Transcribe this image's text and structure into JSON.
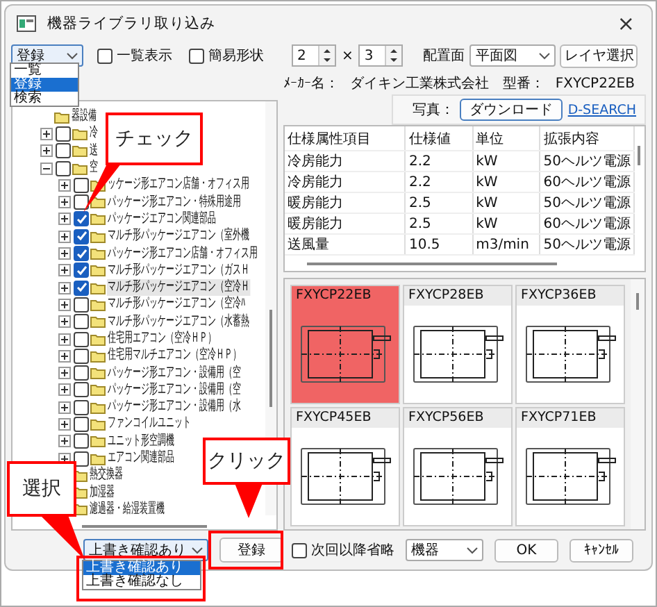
{
  "window": {
    "title": "機器ライブラリ取り込み",
    "close": "×"
  },
  "mode_select": {
    "value": "登録",
    "options": [
      {
        "label": "一覧",
        "selected": false
      },
      {
        "label": "登録",
        "selected": true
      },
      {
        "label": "検索",
        "selected": false
      }
    ]
  },
  "options": [
    {
      "label": "一覧表示",
      "checked": false
    },
    {
      "label": "簡易形状",
      "checked": false
    }
  ],
  "grid_size": {
    "rows": "2",
    "separator": "×",
    "cols": "3"
  },
  "layout_plane": {
    "label": "配置面",
    "value": "平面図"
  },
  "layer_button": "レイヤ選択",
  "maker": {
    "label": "ﾒｰｶｰ名：",
    "value": "ダイキン工業株式会社"
  },
  "model": {
    "label": "型番：",
    "value": "FXYCP22EB"
  },
  "photo": {
    "label": "写真：",
    "button": "ダウンロード",
    "link": "D-SEARCH"
  },
  "tree": {
    "items": [
      {
        "label": "器設備",
        "children": [
          {
            "label": "冷",
            "expanded": false,
            "checked": false
          },
          {
            "label": "送",
            "expanded": false,
            "checked": false
          },
          {
            "label": "空",
            "expanded": true,
            "checked": false,
            "children": [
              {
                "label": "ッケージ形エアコン店舗・オフィス用",
                "expanded": false,
                "checked": false,
                "selected": false
              },
              {
                "label": "パッケージ形エアコン・特殊用途用",
                "expanded": false,
                "checked": false,
                "selected": false
              },
              {
                "label": "パッケージエアコン関連部品",
                "expanded": false,
                "checked": true,
                "selected": false
              },
              {
                "label": "マルチ形パッケージエアコン（室外機",
                "expanded": false,
                "checked": true,
                "selected": false
              },
              {
                "label": "パッケージ形エアコン店舗・オフィス用",
                "expanded": false,
                "checked": true,
                "selected": false
              },
              {
                "label": "マルチ形パッケージエアコン（ガスＨ",
                "expanded": false,
                "checked": true,
                "selected": false
              },
              {
                "label": "マルチ形パッケージエアコン（空冷Ｈ",
                "expanded": false,
                "checked": true,
                "selected": true
              },
              {
                "label": "マルチ形パッケージエアコン（空冷ﾊ",
                "expanded": false,
                "checked": false,
                "selected": false
              },
              {
                "label": "マルチ形パッケージエアコン（水蓄熱",
                "expanded": false,
                "checked": false,
                "selected": false
              },
              {
                "label": "住宅用エアコン（空冷ＨＰ）",
                "expanded": false,
                "checked": false,
                "selected": false
              },
              {
                "label": "住宅用マルチエアコン（空冷ＨＰ）",
                "expanded": false,
                "checked": false,
                "selected": false
              },
              {
                "label": "パッケージ形エアコン・設備用（空",
                "expanded": false,
                "checked": false,
                "selected": false
              },
              {
                "label": "パッケージ形エアコン・設備用（空",
                "expanded": false,
                "checked": false,
                "selected": false
              },
              {
                "label": "パッケージ形エアコン・設備用（水",
                "expanded": false,
                "checked": false,
                "selected": false
              },
              {
                "label": "ファンコイルユニット",
                "expanded": false,
                "checked": false,
                "selected": false
              },
              {
                "label": "ユニット形空調機",
                "expanded": false,
                "checked": false,
                "selected": false
              },
              {
                "label": "エアコン関連部品",
                "expanded": false,
                "checked": false,
                "selected": false
              }
            ]
          },
          {
            "label": "熱交換器"
          },
          {
            "label": "加湿器"
          },
          {
            "label": "濾過器・給湿装置機"
          }
        ]
      }
    ]
  },
  "spec_table": {
    "columns": [
      "仕様属性項目",
      "仕様値",
      "単位",
      "拡張内容"
    ],
    "rows": [
      [
        "冷房能力",
        "2.2",
        "kW",
        "50ヘルツ電源"
      ],
      [
        "冷房能力",
        "2.2",
        "kW",
        "60ヘルツ電源"
      ],
      [
        "暖房能力",
        "2.5",
        "kW",
        "50ヘルツ電源"
      ],
      [
        "暖房能力",
        "2.5",
        "kW",
        "60ヘルツ電源"
      ],
      [
        "送風量",
        "10.5",
        "m3/min",
        "50ヘルツ電源"
      ]
    ]
  },
  "models": [
    {
      "name": "FXYCP22EB",
      "selected": true
    },
    {
      "name": "FXYCP28EB",
      "selected": false
    },
    {
      "name": "FXYCP36EB",
      "selected": false
    },
    {
      "name": "FXYCP45EB",
      "selected": false
    },
    {
      "name": "FXYCP56EB",
      "selected": false
    },
    {
      "name": "FXYCP71EB",
      "selected": false
    }
  ],
  "overwrite_select": {
    "value": "上書き確認あり",
    "options": [
      {
        "label": "上書き確認あり",
        "selected": true
      },
      {
        "label": "上書き確認なし",
        "selected": false
      }
    ]
  },
  "register_button": "登録",
  "skip_next": {
    "label": "次回以降省略",
    "checked": false
  },
  "category_select": {
    "value": "機器"
  },
  "ok_button": "OK",
  "cancel_button": "ｷｬﾝｾﾙ",
  "callouts": [
    {
      "text": "チェック"
    },
    {
      "text": "クリック"
    },
    {
      "text": "選択"
    }
  ]
}
